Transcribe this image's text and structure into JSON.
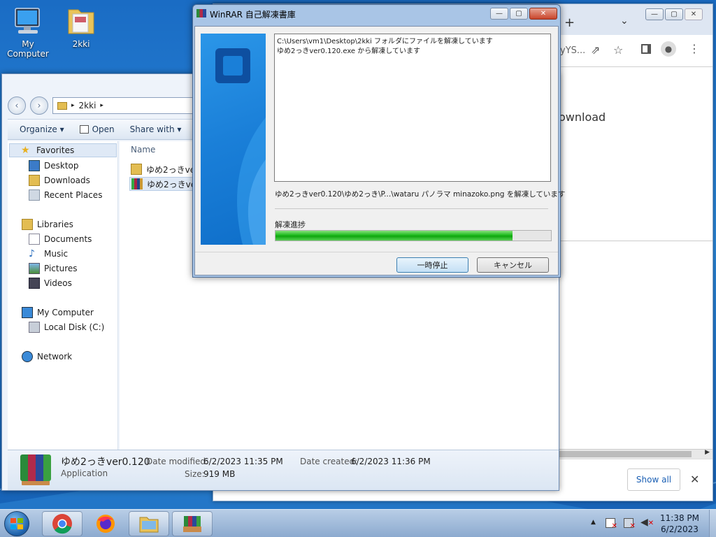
{
  "desktop": {
    "icons": [
      {
        "label": "My Computer"
      },
      {
        "label": "2kki"
      }
    ]
  },
  "chrome": {
    "new_tab": "+",
    "tab_search": "⌄",
    "url_fragment": "yYS...",
    "page_text": "ownload",
    "show_all": "Show all",
    "close_shelf": "✕"
  },
  "explorer": {
    "breadcrumb": {
      "sep1": "▸",
      "folder": "2kki",
      "sep2": "▸"
    },
    "cmdbar": {
      "organize": "Organize ▾",
      "open": "Open",
      "share": "Share with ▾"
    },
    "nav": {
      "favorites": "Favorites",
      "desktop": "Desktop",
      "downloads": "Downloads",
      "recent": "Recent Places",
      "libraries": "Libraries",
      "documents": "Documents",
      "music": "Music",
      "pictures": "Pictures",
      "videos": "Videos",
      "computer": "My Computer",
      "localdisk": "Local Disk (C:)",
      "network": "Network"
    },
    "files": {
      "col_name": "Name",
      "rows": [
        {
          "name": "ゆめ2っきver"
        },
        {
          "name": "ゆめ2っきve"
        }
      ]
    },
    "details": {
      "filename": "ゆめ2っきver0.120",
      "type": "Application",
      "modified_label": "Date modified:",
      "modified_value": "6/2/2023 11:35 PM",
      "created_label": "Date created:",
      "created_value": "6/2/2023 11:36 PM",
      "size_label": "Size:",
      "size_value": "919 MB"
    }
  },
  "winrar": {
    "title": "WinRAR 自己解凍書庫",
    "log_lines": [
      "C:\\Users\\vm1\\Desktop\\2kki フォルダにファイルを解凍しています",
      "ゆめ2っきver0.120.exe から解凍しています"
    ],
    "current": "ゆめ2っきver0.120\\ゆめ2っき\\P...\\wataru パノラマ  minazoko.png を解凍しています",
    "progress_label": "解凍進捗",
    "progress": 0.86,
    "pause_button": "一時停止",
    "cancel_button": "キャンセル"
  },
  "taskbar": {
    "time": "11:38 PM",
    "date": "6/2/2023"
  },
  "colors": {
    "progress_green": "#0ea60e",
    "winrar_banner": "#1a7fd8",
    "desktop_blue": "#1f72c8"
  }
}
